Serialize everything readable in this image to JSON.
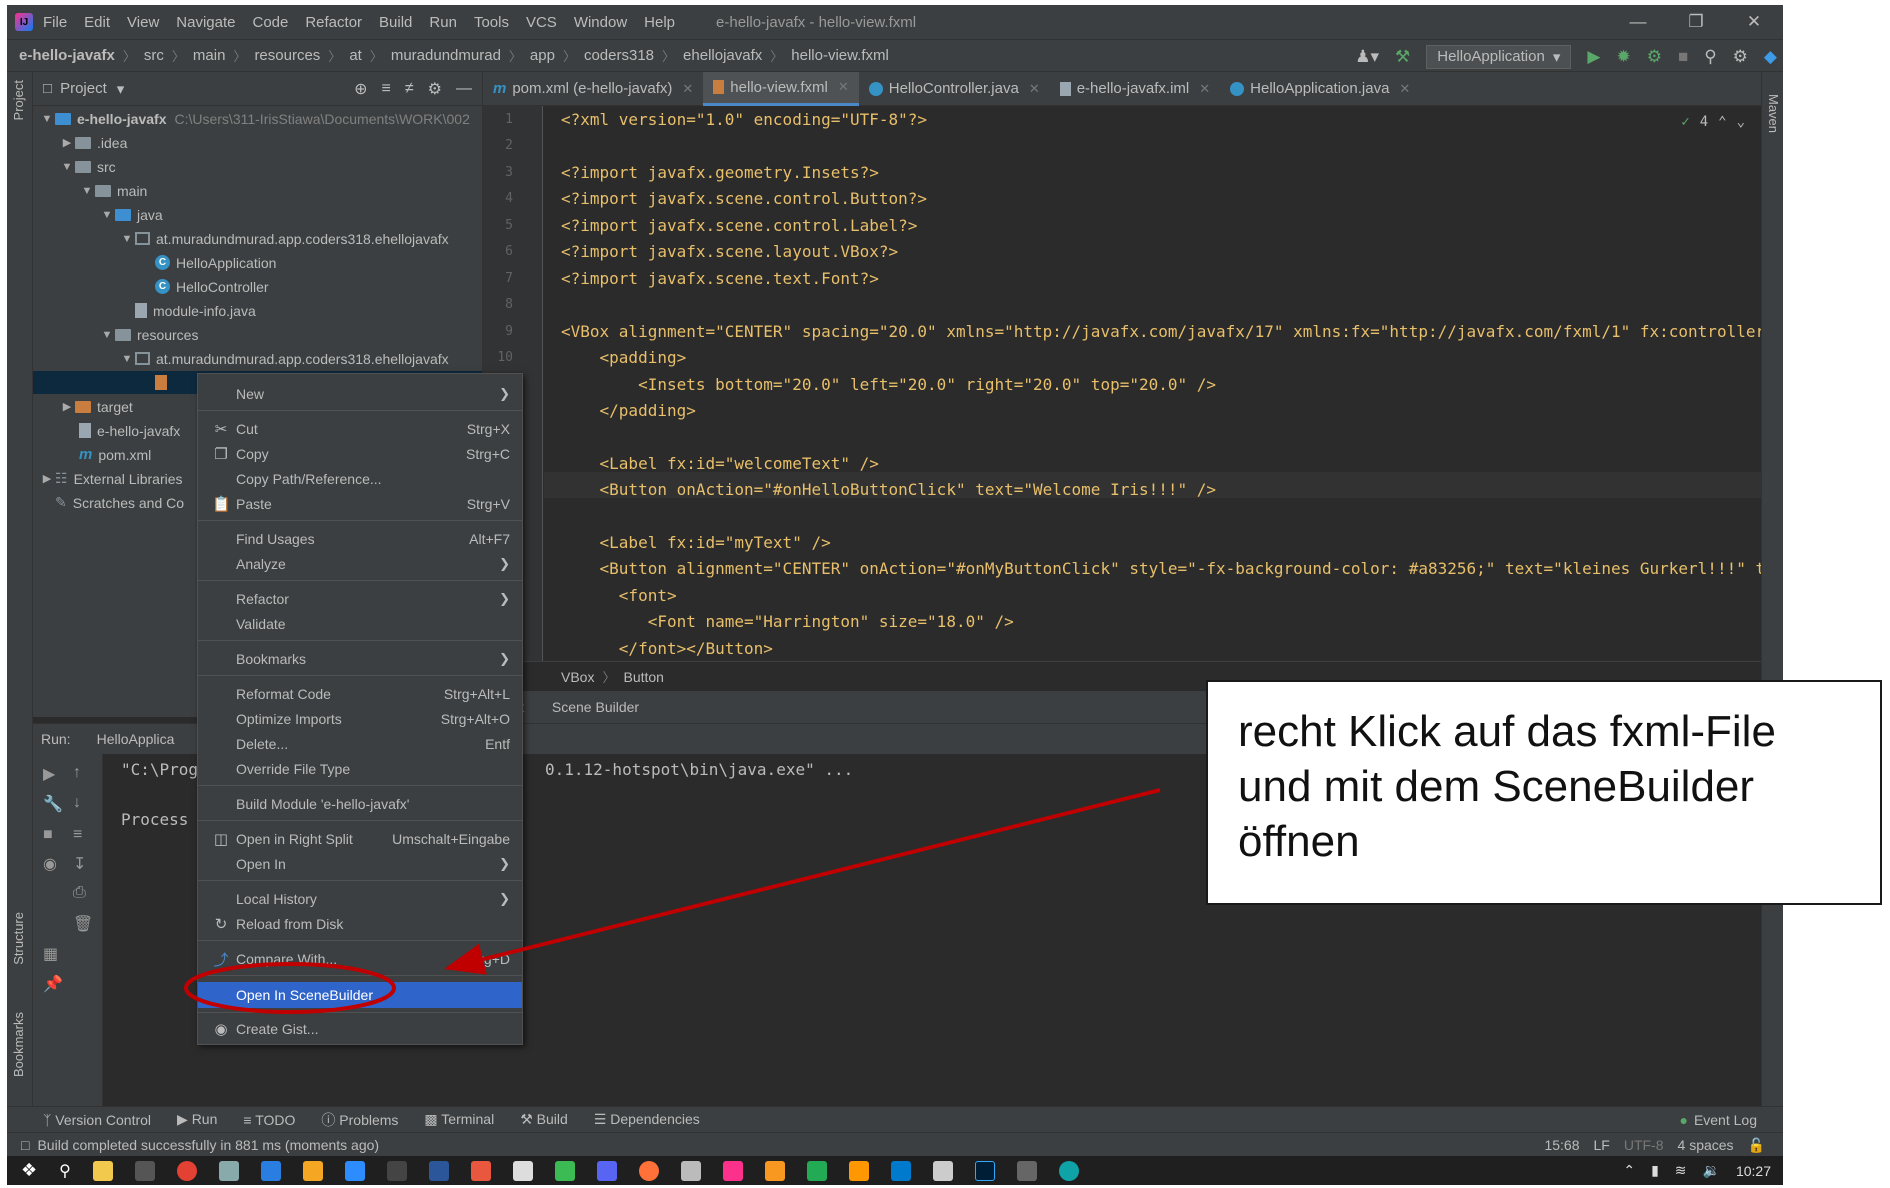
{
  "window": {
    "title": "e-hello-javafx - hello-view.fxml",
    "menu": [
      "File",
      "Edit",
      "View",
      "Navigate",
      "Code",
      "Refactor",
      "Build",
      "Run",
      "Tools",
      "VCS",
      "Window",
      "Help"
    ]
  },
  "breadcrumb": [
    "e-hello-javafx",
    "src",
    "main",
    "resources",
    "at",
    "muradundmurad",
    "app",
    "coders318",
    "ehellojavafx",
    "hello-view.fxml"
  ],
  "toolbar": {
    "run_config": "HelloApplication"
  },
  "project": {
    "title": "Project",
    "tree": [
      {
        "label": "e-hello-javafx",
        "path": "C:\\Users\\311-IrisStiawa\\Documents\\WORK\\002",
        "depth": 0,
        "icon": "module-folder-icon",
        "expanded": true
      },
      {
        "label": ".idea",
        "depth": 1,
        "icon": "folder-icon",
        "expanded": false
      },
      {
        "label": "src",
        "depth": 1,
        "icon": "folder-icon",
        "expanded": true
      },
      {
        "label": "main",
        "depth": 2,
        "icon": "folder-icon",
        "expanded": true
      },
      {
        "label": "java",
        "depth": 3,
        "icon": "source-folder-icon",
        "expanded": true
      },
      {
        "label": "at.muradundmurad.app.coders318.ehellojavafx",
        "depth": 4,
        "icon": "package-icon",
        "expanded": true
      },
      {
        "label": "HelloApplication",
        "depth": 5,
        "icon": "class-icon"
      },
      {
        "label": "HelloController",
        "depth": 5,
        "icon": "class-icon"
      },
      {
        "label": "module-info.java",
        "depth": 4,
        "icon": "java-file-icon"
      },
      {
        "label": "resources",
        "depth": 3,
        "icon": "resources-folder-icon",
        "expanded": true
      },
      {
        "label": "at.muradundmurad.app.coders318.ehellojavafx",
        "depth": 4,
        "icon": "package-icon",
        "expanded": true
      },
      {
        "label": "",
        "depth": 5,
        "icon": "fxml-file-icon",
        "selected": true
      },
      {
        "label": "target",
        "depth": 1,
        "icon": "excluded-folder-icon",
        "expanded": false
      },
      {
        "label": "e-hello-javafx",
        "depth": 1,
        "icon": "iml-file-icon"
      },
      {
        "label": "pom.xml",
        "depth": 1,
        "icon": "maven-icon"
      },
      {
        "label": "External Libraries",
        "depth": 0,
        "icon": "library-icon",
        "expanded": false
      },
      {
        "label": "Scratches and Co",
        "depth": 0,
        "icon": "scratches-icon"
      }
    ]
  },
  "editor": {
    "tabs": [
      {
        "label": "pom.xml (e-hello-javafx)",
        "icon": "maven-icon",
        "active": false
      },
      {
        "label": "hello-view.fxml",
        "icon": "fxml-file-icon",
        "active": true
      },
      {
        "label": "HelloController.java",
        "icon": "class-icon",
        "active": false
      },
      {
        "label": "e-hello-javafx.iml",
        "icon": "iml-file-icon",
        "active": false
      },
      {
        "label": "HelloApplication.java",
        "icon": "class-icon",
        "active": false
      }
    ],
    "inspection_count": "4",
    "line_numbers": [
      "1",
      "2",
      "3",
      "4",
      "5",
      "6",
      "7",
      "8",
      "9",
      "10"
    ],
    "code": {
      "l1": "<?xml version=\"1.0\" encoding=\"UTF-8\"?>",
      "l3": "<?import javafx.geometry.Insets?>",
      "l4": "<?import javafx.scene.control.Button?>",
      "l5": "<?import javafx.scene.control.Label?>",
      "l6": "<?import javafx.scene.layout.VBox?>",
      "l7": "<?import javafx.scene.text.Font?>",
      "l9": "<VBox alignment=\"CENTER\" spacing=\"20.0\" xmlns=\"http://javafx.com/javafx/17\" xmlns:fx=\"http://javafx.com/fxml/1\" fx:controller=\"a",
      "l10": "    <padding>",
      "l11": "        <Insets bottom=\"20.0\" left=\"20.0\" right=\"20.0\" top=\"20.0\" />",
      "l12": "    </padding>",
      "l14": "    <Label fx:id=\"welcomeText\" />",
      "l15": "    <Button onAction=\"#onHelloButtonClick\" text=\"Welcome Iris!!!\" />",
      "l17": "    <Label fx:id=\"myText\" />",
      "l18": "    <Button alignment=\"CENTER\" onAction=\"#onMyButtonClick\" style=\"-fx-background-color: #a83256;\" text=\"kleines Gurkerl!!!\" tex",
      "l19": "      <font>",
      "l20": "         <Font name=\"Harrington\" size=\"18.0\" />",
      "l21": "      </font></Button>"
    },
    "breadcrumb": [
      "VBox",
      "Button"
    ],
    "mode_tabs": [
      "xt",
      "Scene Builder"
    ]
  },
  "run": {
    "label": "Run:",
    "tab": "HelloApplica",
    "console_line1": "\"C:\\Prog",
    "console_line1_tail": "0.1.12-hotspot\\bin\\java.exe\" ...",
    "console_line2": "Process"
  },
  "context_menu": {
    "items": [
      {
        "label": "New",
        "shortcut": "",
        "submenu": true,
        "icon": ""
      },
      {
        "label": "Cut",
        "shortcut": "Strg+X",
        "icon": "scissors-icon"
      },
      {
        "label": "Copy",
        "shortcut": "Strg+C",
        "icon": "copy-icon"
      },
      {
        "label": "Copy Path/Reference...",
        "shortcut": ""
      },
      {
        "label": "Paste",
        "shortcut": "Strg+V",
        "icon": "paste-icon"
      },
      {
        "label": "Find Usages",
        "shortcut": "Alt+F7"
      },
      {
        "label": "Analyze",
        "submenu": true
      },
      {
        "label": "Refactor",
        "submenu": true
      },
      {
        "label": "Validate"
      },
      {
        "label": "Bookmarks",
        "submenu": true
      },
      {
        "label": "Reformat Code",
        "shortcut": "Strg+Alt+L"
      },
      {
        "label": "Optimize Imports",
        "shortcut": "Strg+Alt+O"
      },
      {
        "label": "Delete...",
        "shortcut": "Entf"
      },
      {
        "label": "Override File Type"
      },
      {
        "label": "Build Module 'e-hello-javafx'"
      },
      {
        "label": "Open in Right Split",
        "shortcut": "Umschalt+Eingabe",
        "icon": "split-icon"
      },
      {
        "label": "Open In",
        "submenu": true
      },
      {
        "label": "Local History",
        "submenu": true
      },
      {
        "label": "Reload from Disk",
        "icon": "reload-icon"
      },
      {
        "label": "Compare With...",
        "shortcut": "Strg+D",
        "icon": "compare-icon"
      },
      {
        "label": "Open In SceneBuilder",
        "highlight": true
      },
      {
        "label": "Create Gist...",
        "icon": "github-icon"
      }
    ]
  },
  "tool_tabs": [
    "Version Control",
    "Run",
    "TODO",
    "Problems",
    "Terminal",
    "Build",
    "Dependencies"
  ],
  "event_log": "Event Log",
  "status": {
    "message": "Build completed successfully in 881 ms (moments ago)",
    "position": "15:68",
    "line_sep": "LF",
    "encoding": "UTF-8",
    "indent": "4 spaces"
  },
  "stripes": {
    "project": "Project",
    "structure": "Structure",
    "bookmarks": "Bookmarks",
    "maven": "Maven"
  },
  "taskbar": {
    "clock": "10:27"
  },
  "annotation": {
    "callout_text": "recht Klick auf das fxml-File und mit dem SceneBuilder öffnen",
    "arrow_color": "#c00000",
    "highlight_color": "#c00000"
  }
}
